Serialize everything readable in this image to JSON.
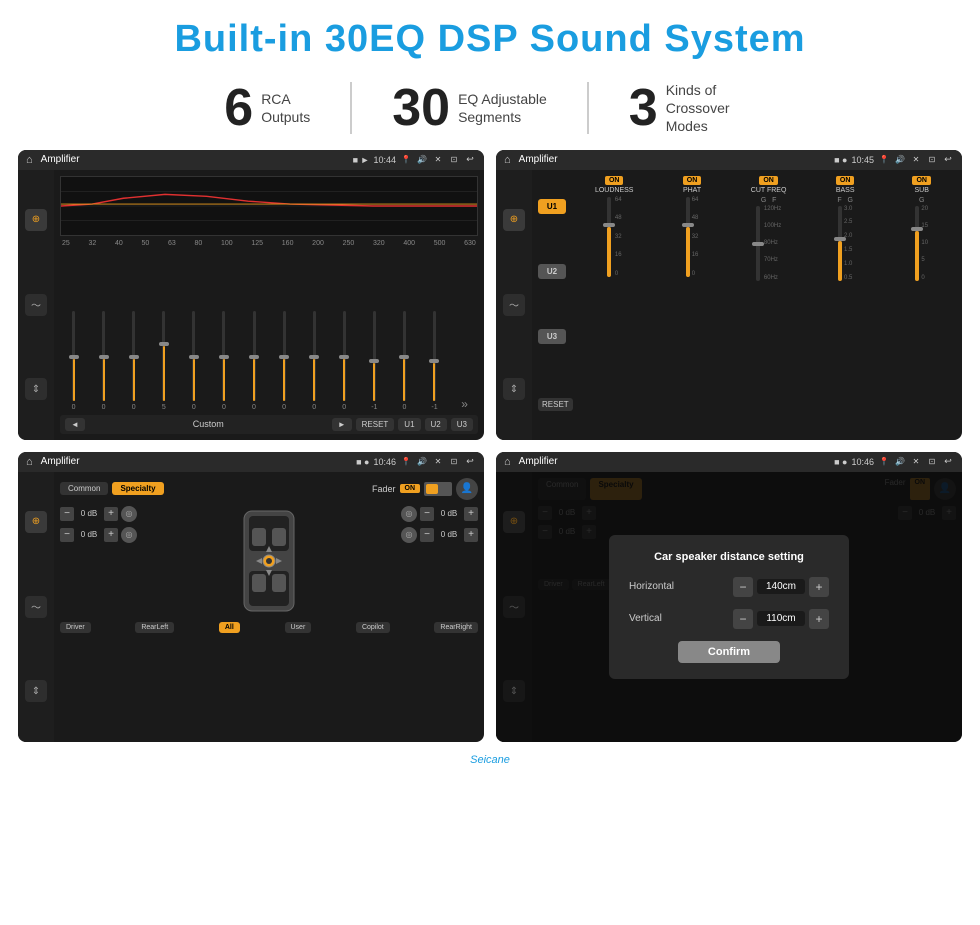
{
  "header": {
    "title": "Built-in 30EQ DSP Sound System",
    "title_color": "#1a9de0"
  },
  "stats": [
    {
      "number": "6",
      "label": "RCA\nOutputs"
    },
    {
      "number": "30",
      "label": "EQ Adjustable\nSegments"
    },
    {
      "number": "3",
      "label": "Kinds of\nCrossover Modes"
    }
  ],
  "screens": [
    {
      "id": "screen1",
      "topbar": {
        "app": "Amplifier",
        "time": "10:44"
      },
      "type": "eq",
      "bottom_buttons": [
        "◄",
        "Custom",
        "►",
        "RESET",
        "U1",
        "U2",
        "U3"
      ],
      "freq_labels": [
        "25",
        "32",
        "40",
        "50",
        "63",
        "80",
        "100",
        "125",
        "160",
        "200",
        "250",
        "320",
        "400",
        "500",
        "630"
      ],
      "slider_values": [
        "0",
        "0",
        "0",
        "5",
        "0",
        "0",
        "0",
        "0",
        "0",
        "0",
        "-1",
        "0",
        "-1"
      ]
    },
    {
      "id": "screen2",
      "topbar": {
        "app": "Amplifier",
        "time": "10:45"
      },
      "type": "amp",
      "u_buttons": [
        "U1",
        "U2",
        "U3"
      ],
      "controls": [
        {
          "label": "LOUDNESS",
          "on": true
        },
        {
          "label": "PHAT",
          "on": true
        },
        {
          "label": "CUT FREQ",
          "on": true
        },
        {
          "label": "BASS",
          "on": true
        },
        {
          "label": "SUB",
          "on": true
        }
      ],
      "reset_label": "RESET"
    },
    {
      "id": "screen3",
      "topbar": {
        "app": "Amplifier",
        "time": "10:46"
      },
      "type": "fader",
      "tabs": [
        "Common",
        "Specialty"
      ],
      "fader_label": "Fader",
      "on_label": "ON",
      "db_values": [
        "0 dB",
        "0 dB",
        "0 dB",
        "0 dB"
      ],
      "bottom_buttons": [
        "Driver",
        "RearLeft",
        "All",
        "User",
        "Copilot",
        "RearRight"
      ]
    },
    {
      "id": "screen4",
      "topbar": {
        "app": "Amplifier",
        "time": "10:46"
      },
      "type": "fader_dialog",
      "tabs": [
        "Common",
        "Specialty"
      ],
      "on_label": "ON",
      "db_values": [
        "0 dB",
        "0 dB"
      ],
      "dialog": {
        "title": "Car speaker distance setting",
        "horizontal_label": "Horizontal",
        "horizontal_value": "140cm",
        "vertical_label": "Vertical",
        "vertical_value": "110cm",
        "confirm_label": "Confirm"
      },
      "bottom_buttons": [
        "Driver",
        "RearLeft",
        "Copilot",
        "RearRight"
      ]
    }
  ],
  "watermark": "Seicane"
}
